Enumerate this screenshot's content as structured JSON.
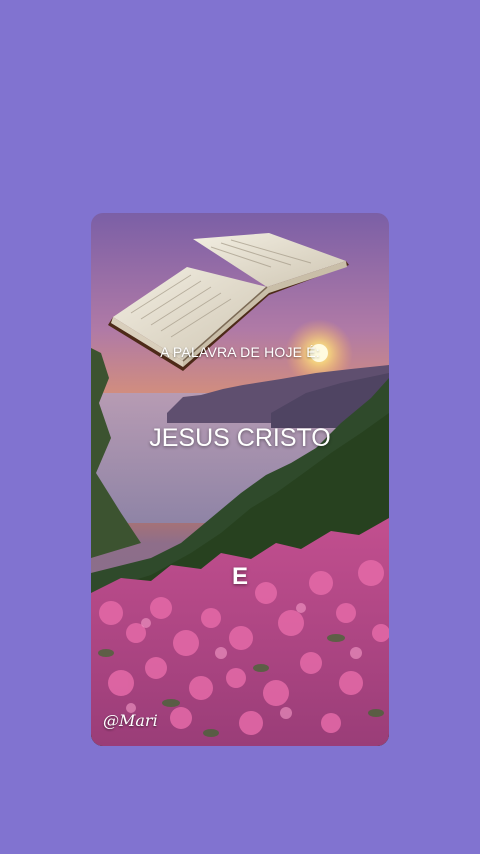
{
  "background_color": "#8173d0",
  "story": {
    "line1": "A PALAVRA DE HOJE É:",
    "line2": "JESUS CRISTO",
    "line3": "E",
    "watermark": "@Mari"
  },
  "decorations": {
    "book_icon": "open-bible-icon",
    "scene": "sunset-coast-azalea-flowers"
  }
}
